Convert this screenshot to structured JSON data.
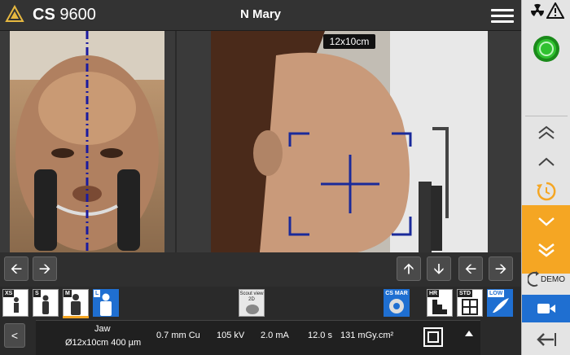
{
  "header": {
    "brand": "CS",
    "model": "9600",
    "patient_name": "N Mary"
  },
  "camera": {
    "field_of_view": "12x10cm"
  },
  "programs": {
    "xs_tag": "XS",
    "s_tag": "S",
    "m_tag": "M",
    "l_tag": "L",
    "scout_label": "Scout view",
    "scout_sub": "2D",
    "csmar_label": "CS MAR",
    "hr_label": "HR",
    "std_label": "STD",
    "low_label": "LOW"
  },
  "acquisition": {
    "region": "Jaw",
    "fov_resolution": "Ø12x10cm 400 µm",
    "filter": "0.7 mm Cu",
    "voltage": "105 kV",
    "current": "2.0 mA",
    "time": "12.0 s",
    "dose": "131 mGy.cm²"
  },
  "sidebar": {
    "demo_label": "DEMO"
  },
  "colors": {
    "accent_blue": "#1f6fd1",
    "accent_orange": "#f5a623",
    "status_green": "#2fc12f",
    "crosshair_blue": "#1a2a9a"
  }
}
